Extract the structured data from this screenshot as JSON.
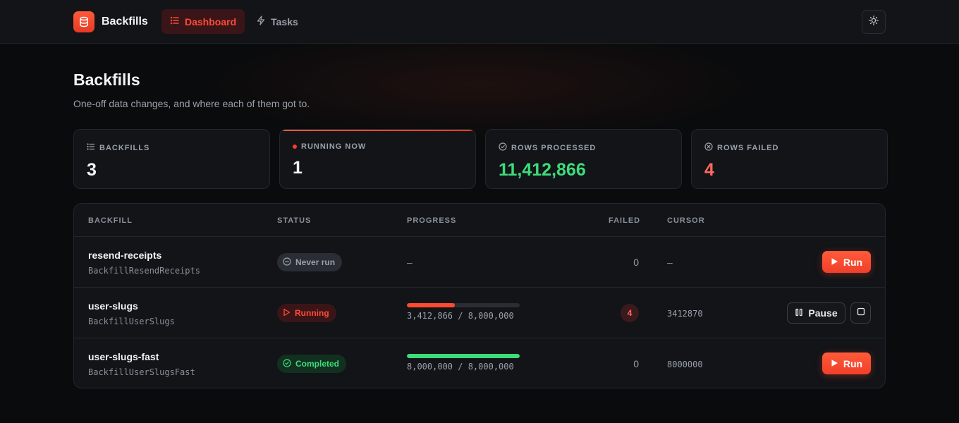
{
  "header": {
    "brand": "Backfills",
    "nav": [
      {
        "label": "Dashboard",
        "icon": "list-icon",
        "active": true
      },
      {
        "label": "Tasks",
        "icon": "bolt-icon",
        "active": false
      }
    ],
    "theme_toggle_icon": "sun-icon"
  },
  "page": {
    "title": "Backfills",
    "subtitle": "One-off data changes, and where each of them got to."
  },
  "stats": [
    {
      "label": "BACKFILLS",
      "value": "3",
      "icon": "list-icon"
    },
    {
      "label": "RUNNING NOW",
      "value": "1",
      "icon": "dot-icon"
    },
    {
      "label": "ROWS PROCESSED",
      "value": "11,412,866",
      "icon": "check-circle-icon"
    },
    {
      "label": "ROWS FAILED",
      "value": "4",
      "icon": "x-circle-icon"
    }
  ],
  "table": {
    "columns": [
      "BACKFILL",
      "STATUS",
      "PROGRESS",
      "FAILED",
      "CURSOR"
    ],
    "rows": [
      {
        "name": "resend-receipts",
        "class": "BackfillResendReceipts",
        "status": "Never run",
        "progress_text": "–",
        "failed": "0",
        "cursor": "–",
        "action": "Run"
      },
      {
        "name": "user-slugs",
        "class": "BackfillUserSlugs",
        "status": "Running",
        "progress_text": "3,412,866 / 8,000,000",
        "progress_fraction": 0.4266,
        "failed": "4",
        "cursor": "3412870",
        "action": "Pause"
      },
      {
        "name": "user-slugs-fast",
        "class": "BackfillUserSlugsFast",
        "status": "Completed",
        "progress_text": "8,000,000 / 8,000,000",
        "progress_fraction": 1.0,
        "failed": "0",
        "cursor": "8000000",
        "action": "Run"
      }
    ]
  },
  "colors": {
    "accent": "#ff4a30",
    "success": "#3ddc7a",
    "danger": "#ff6b5a"
  }
}
